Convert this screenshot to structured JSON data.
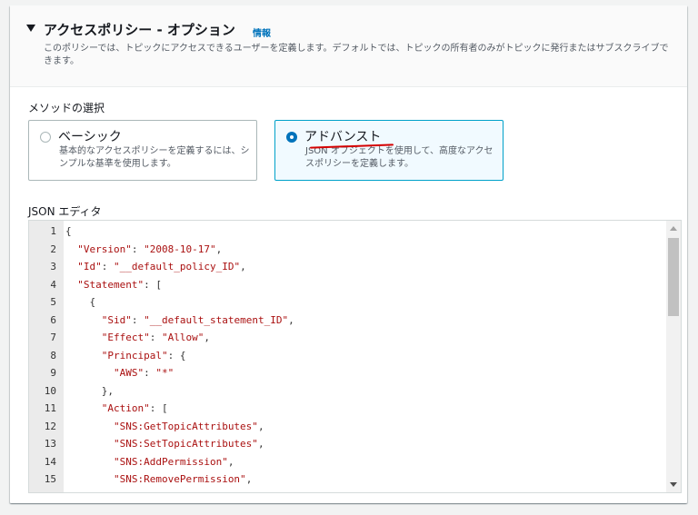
{
  "section": {
    "title": "アクセスポリシー - オプション",
    "info_link": "情報",
    "description": "このポリシーでは、トピックにアクセスできるユーザーを定義します。デフォルトでは、トピックの所有者のみがトピックに発行またはサブスクライブできます。"
  },
  "method": {
    "label": "メソッドの選択",
    "options": [
      {
        "title": "ベーシック",
        "description": "基本的なアクセスポリシーを定義するには、シンプルな基準を使用します。",
        "selected": false
      },
      {
        "title": "アドバンスト",
        "description": "JSON オブジェクトを使用して、高度なアクセスポリシーを定義します。",
        "selected": true
      }
    ]
  },
  "editor": {
    "label": "JSON エディタ",
    "lines": [
      {
        "num": "1",
        "code": "{"
      },
      {
        "num": "2",
        "code": "  \"Version\": \"2008-10-17\","
      },
      {
        "num": "3",
        "code": "  \"Id\": \"__default_policy_ID\","
      },
      {
        "num": "4",
        "code": "  \"Statement\": ["
      },
      {
        "num": "5",
        "code": "    {"
      },
      {
        "num": "6",
        "code": "      \"Sid\": \"__default_statement_ID\","
      },
      {
        "num": "7",
        "code": "      \"Effect\": \"Allow\","
      },
      {
        "num": "8",
        "code": "      \"Principal\": {"
      },
      {
        "num": "9",
        "code": "        \"AWS\": \"*\""
      },
      {
        "num": "10",
        "code": "      },"
      },
      {
        "num": "11",
        "code": "      \"Action\": ["
      },
      {
        "num": "12",
        "code": "        \"SNS:GetTopicAttributes\","
      },
      {
        "num": "13",
        "code": "        \"SNS:SetTopicAttributes\","
      },
      {
        "num": "14",
        "code": "        \"SNS:AddPermission\","
      },
      {
        "num": "15",
        "code": "        \"SNS:RemovePermission\","
      }
    ]
  },
  "colors": {
    "accent": "#0073bb",
    "selected_border": "#00a1c9",
    "string": "#aa1111",
    "annotation": "#d40000"
  },
  "icons": {
    "caret": "caret-down-icon",
    "scroll_up": "scroll-up-arrow-icon",
    "scroll_down": "scroll-down-arrow-icon"
  }
}
